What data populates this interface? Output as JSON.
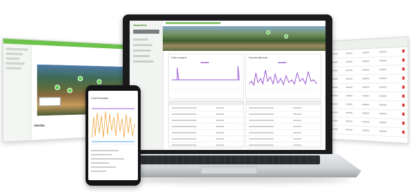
{
  "left_panel": {
    "logo_text": "",
    "header_text": "",
    "subtitle_text": "",
    "footer_text": "Alertas"
  },
  "laptop": {
    "app_logo": "ChaleTech",
    "charts": [
      {
        "title": "Cota usuario"
      },
      {
        "title": "Caudal afluente"
      }
    ]
  },
  "phone": {
    "title": "Cota Embalse"
  },
  "colors": {
    "brand_green": "#6dc24b",
    "accent_purple": "#9b59d6",
    "accent_orange": "#f2a33a",
    "accent_blue": "#4aa3df",
    "alert_red": "#d9352a"
  }
}
